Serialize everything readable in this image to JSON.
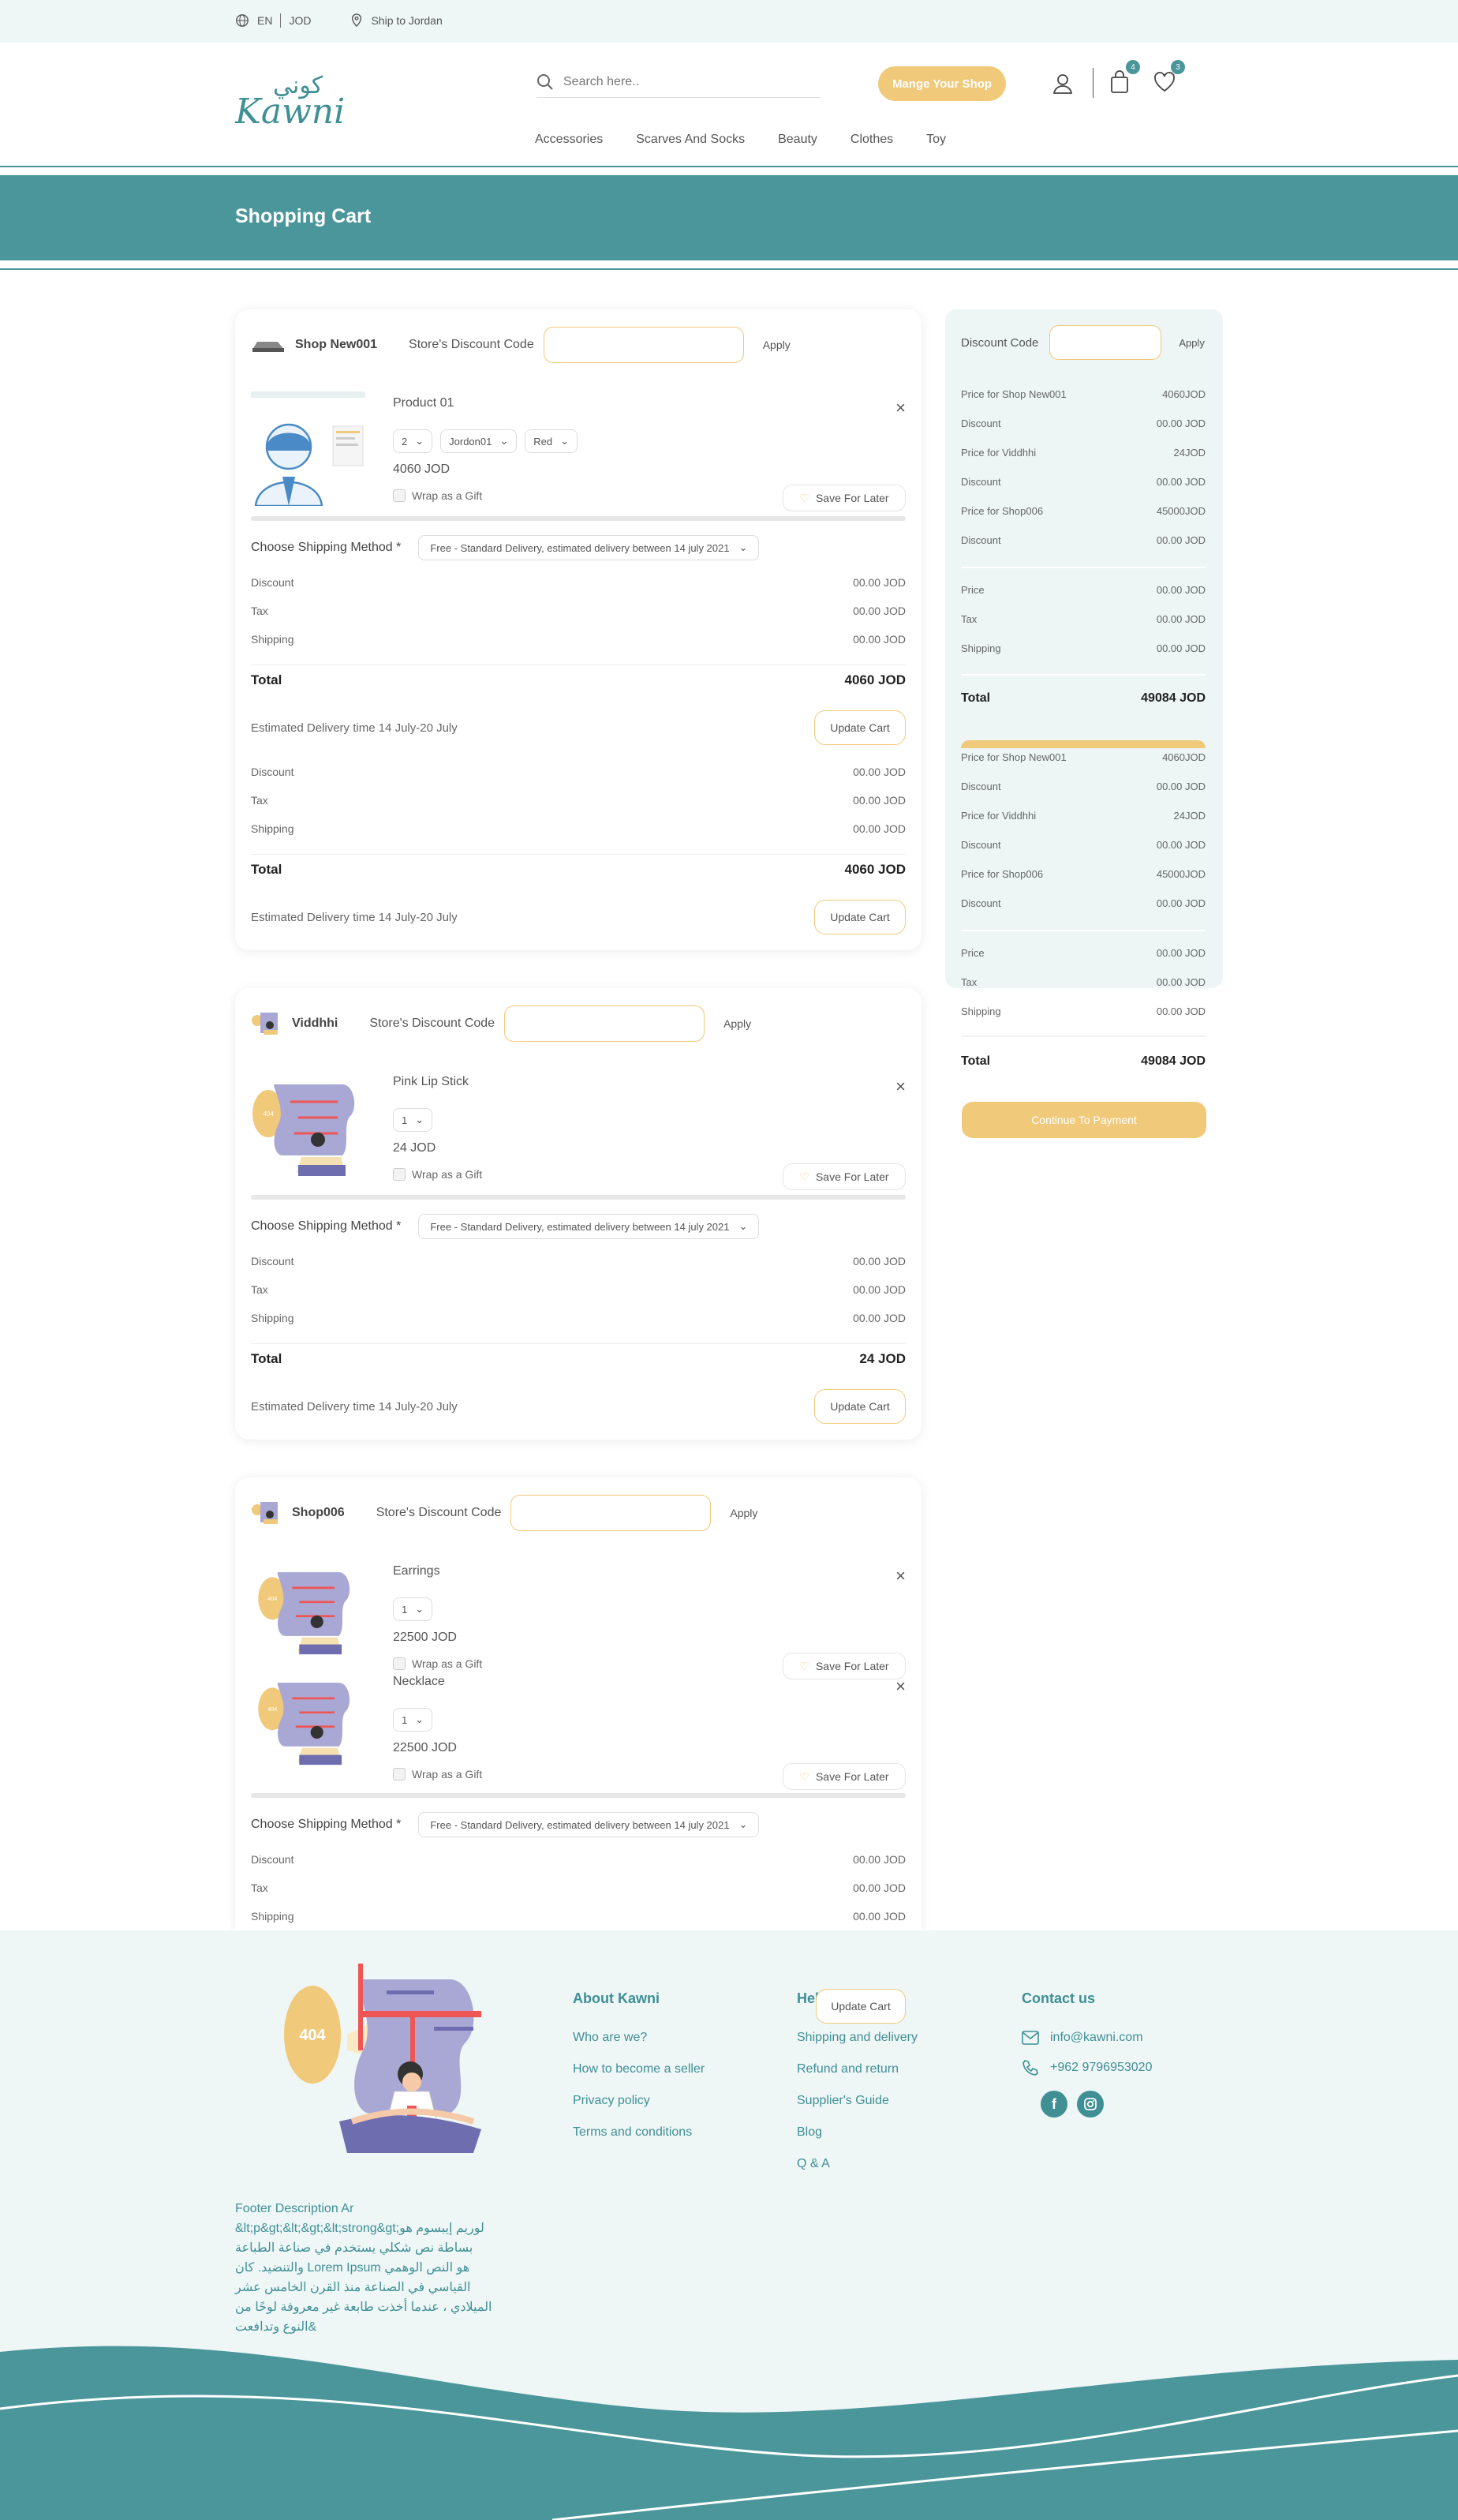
{
  "topbar": {
    "lang": "EN",
    "currency": "JOD",
    "ship_to": "Ship to Jordan"
  },
  "header": {
    "logo_arabic": "كوني",
    "logo_latin": "Kawni",
    "search_placeholder": "Search here..",
    "mange_label": "Mange Your Shop",
    "cart_count": "4",
    "wishlist_count": "3"
  },
  "nav": [
    "Accessories",
    "Scarves And Socks",
    "Beauty",
    "Clothes",
    "Toy"
  ],
  "banner": {
    "title": "Shopping Cart"
  },
  "labels": {
    "store_discount": "Store's Discount Code",
    "apply": "Apply",
    "wrap_gift": "Wrap as a Gift",
    "save_later": "Save For Later",
    "choose_shipping": "Choose Shipping Method *",
    "shipping_option": "Free - Standard Delivery, estimated delivery between 14 july 2021",
    "discount": "Discount",
    "tax": "Tax",
    "shipping": "Shipping",
    "total": "Total",
    "estimated": "Estimated Delivery time 14 July-20 July",
    "update_cart": "Update Cart",
    "zero": "00.00 JOD"
  },
  "shops": [
    {
      "name": "Shop New001",
      "products": [
        {
          "name": "Product 01",
          "qty": "2",
          "size": "Jordon01",
          "color": "Red",
          "price": "4060 JOD"
        }
      ],
      "total": "4060 JOD"
    },
    {
      "name": "Viddhhi",
      "products": [
        {
          "name": "Pink Lip Stick",
          "qty": "1",
          "price": "24 JOD"
        }
      ],
      "total": "24 JOD"
    },
    {
      "name": "Shop006",
      "products": [
        {
          "name": "Earrings",
          "qty": "1",
          "price": "22500 JOD"
        },
        {
          "name": "Necklace",
          "qty": "1",
          "price": "22500 JOD"
        }
      ]
    }
  ],
  "summary": {
    "discount_code": "Discount Code",
    "apply": "Apply",
    "rows": [
      [
        "Price for Shop New001",
        "4060JOD"
      ],
      [
        "Discount",
        "00.00 JOD"
      ],
      [
        "Price for Viddhhi",
        "24JOD"
      ],
      [
        "Discount",
        "00.00 JOD"
      ],
      [
        "Price for Shop006",
        "45000JOD"
      ],
      [
        "Discount",
        "00.00 JOD"
      ]
    ],
    "rows2": [
      [
        "Price",
        "00.00 JOD"
      ],
      [
        "Tax",
        "00.00 JOD"
      ],
      [
        "Shipping",
        "00.00 JOD"
      ]
    ],
    "total": "49084 JOD",
    "continue": "Continue To Payment"
  },
  "footer": {
    "about": {
      "title": "About Kawni",
      "links": [
        "Who are we?",
        "How to become a seller",
        "Privacy policy",
        "Terms and conditions"
      ]
    },
    "help": {
      "title": "Help",
      "links": [
        "Shipping and delivery",
        "Refund and return",
        "Supplier's Guide",
        "Blog",
        "Q & A"
      ]
    },
    "contact": {
      "title": "Contact us",
      "email": "info@kawni.com",
      "phone": "+962 9796953020"
    },
    "desc_title": "Footer Description Ar",
    "desc": "&lt;p&gt;&lt;&gt;&lt;strong&gt;لوريم إيبسوم هو بساطة نص شكلي يستخدم في صناعة الطباعة والتنضيد. كان Lorem Ipsum هو النص الوهمي القياسي في الصناعة منذ القرن الخامس عشر الميلادي ، عندما أخذت طابعة غير معروفة لوحًا من النوع وتدافعت&",
    "img_404": "404"
  },
  "colors": {
    "teal": "#4b969b",
    "gold": "#f0c97a",
    "bg": "#eef6f6"
  }
}
